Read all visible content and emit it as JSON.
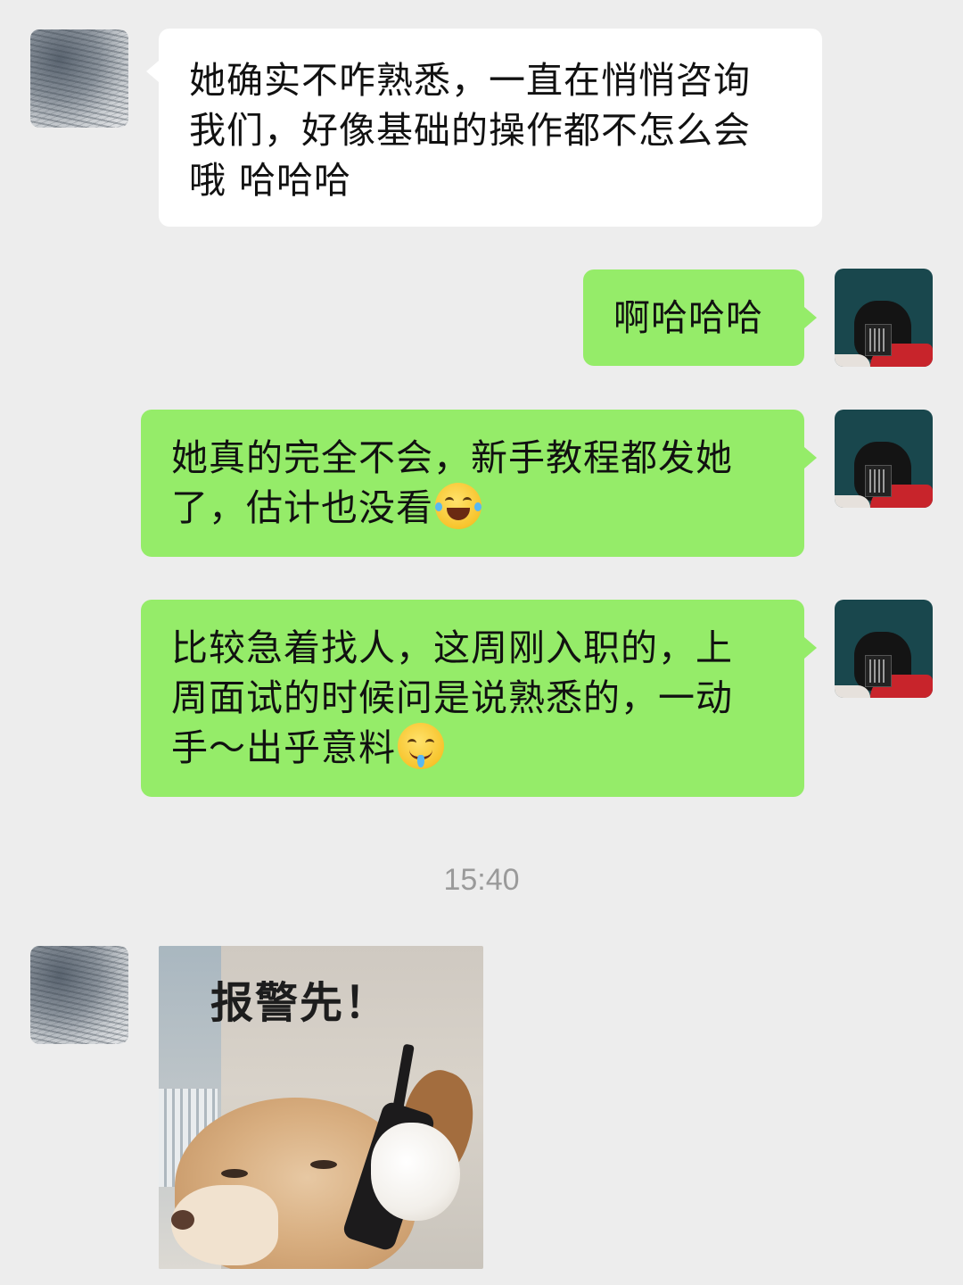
{
  "messages": [
    {
      "side": "left",
      "lines": [
        "她确实不咋熟悉，一直在悄悄咨询",
        "我们，好像基础的操作都不怎么会",
        "哦 哈哈哈"
      ]
    },
    {
      "side": "right",
      "lines": [
        "啊哈哈哈"
      ]
    },
    {
      "side": "right",
      "lines": [
        "她真的完全不会，新手教程都发她",
        "了，估计也没看"
      ],
      "emoji": "tears-of-joy"
    },
    {
      "side": "right",
      "lines": [
        "比较急着找人，这周刚入职的，上",
        "周面试的时候问是说熟悉的，一动",
        "手～出乎意料"
      ],
      "emoji": "drooling-face"
    }
  ],
  "timestamp": "15:40",
  "sticker": {
    "caption": "报警先！"
  },
  "colors": {
    "background": "#ededed",
    "bubble_sent": "#95ec69",
    "bubble_received": "#ffffff",
    "timestamp": "#9a9a9a"
  },
  "icons": {
    "emoji_1": "tears-of-joy-emoji-icon",
    "emoji_2": "drooling-face-emoji-icon"
  }
}
